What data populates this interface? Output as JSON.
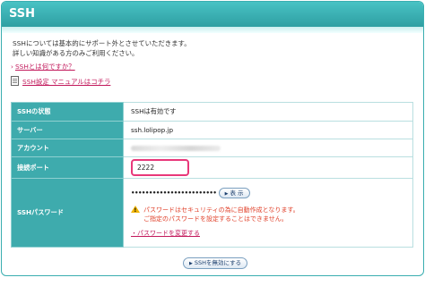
{
  "header": {
    "title": "SSH"
  },
  "intro": {
    "line1": "SSHについては基本的にサポート外とさせていただきます。",
    "line2": "詳しい知識がある方のみご利用ください。"
  },
  "links": {
    "what_is_ssh": "SSHとは何ですか？",
    "manual": "SSH設定 マニュアルはコチラ"
  },
  "table": {
    "status_label": "SSHの状態",
    "status_value": "SSHは有効です",
    "server_label": "サーバー",
    "server_value": "ssh.lolipop.jp",
    "account_label": "アカウント",
    "port_label": "接続ポート",
    "port_value": "2222",
    "password_label": "SSHパスワード",
    "password_mask": "••••••••••••••••••••••••",
    "show_button": "表 示",
    "warning_line1": "パスワードはセキュリティの為に自動作成となります。",
    "warning_line2": "ご指定のパスワードを設定することはできません。",
    "change_link": "・パスワードを変更する"
  },
  "footer": {
    "disable_button": "SSHを無効にする"
  },
  "colors": {
    "header": "#3aaeb0",
    "label_cell": "#3eabad",
    "link": "#c2185b",
    "port_highlight": "#e8387a",
    "warning": "#e0402a"
  }
}
